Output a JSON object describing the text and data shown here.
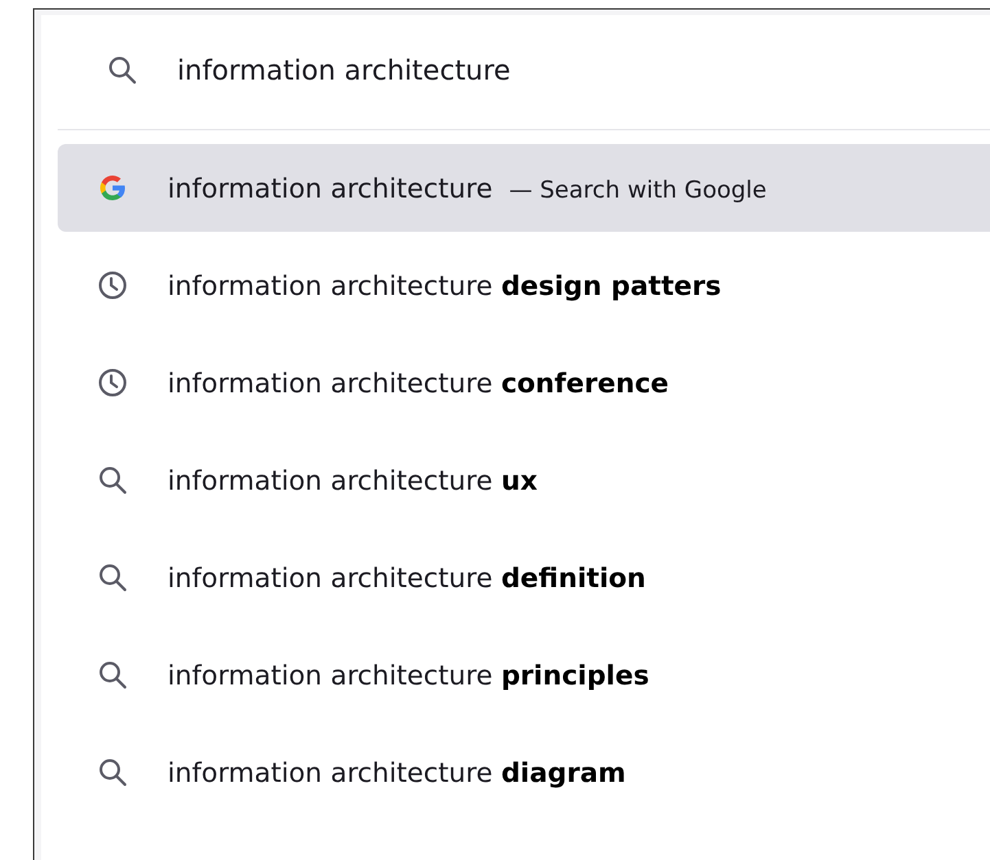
{
  "search": {
    "value": "information architecture"
  },
  "suggestions": [
    {
      "kind": "google",
      "text": "information architecture",
      "action": "— Search with Google",
      "selected": true
    },
    {
      "kind": "history",
      "text": "information architecture **design patters**",
      "selected": false
    },
    {
      "kind": "history",
      "text": "information architecture **conference**",
      "selected": false
    },
    {
      "kind": "search",
      "text": "information architecture **ux**",
      "selected": false
    },
    {
      "kind": "search",
      "text": "information architecture **definition**",
      "selected": false
    },
    {
      "kind": "search",
      "text": "information architecture **principles**",
      "selected": false
    },
    {
      "kind": "search",
      "text": "information architecture **diagram**",
      "selected": false
    }
  ]
}
